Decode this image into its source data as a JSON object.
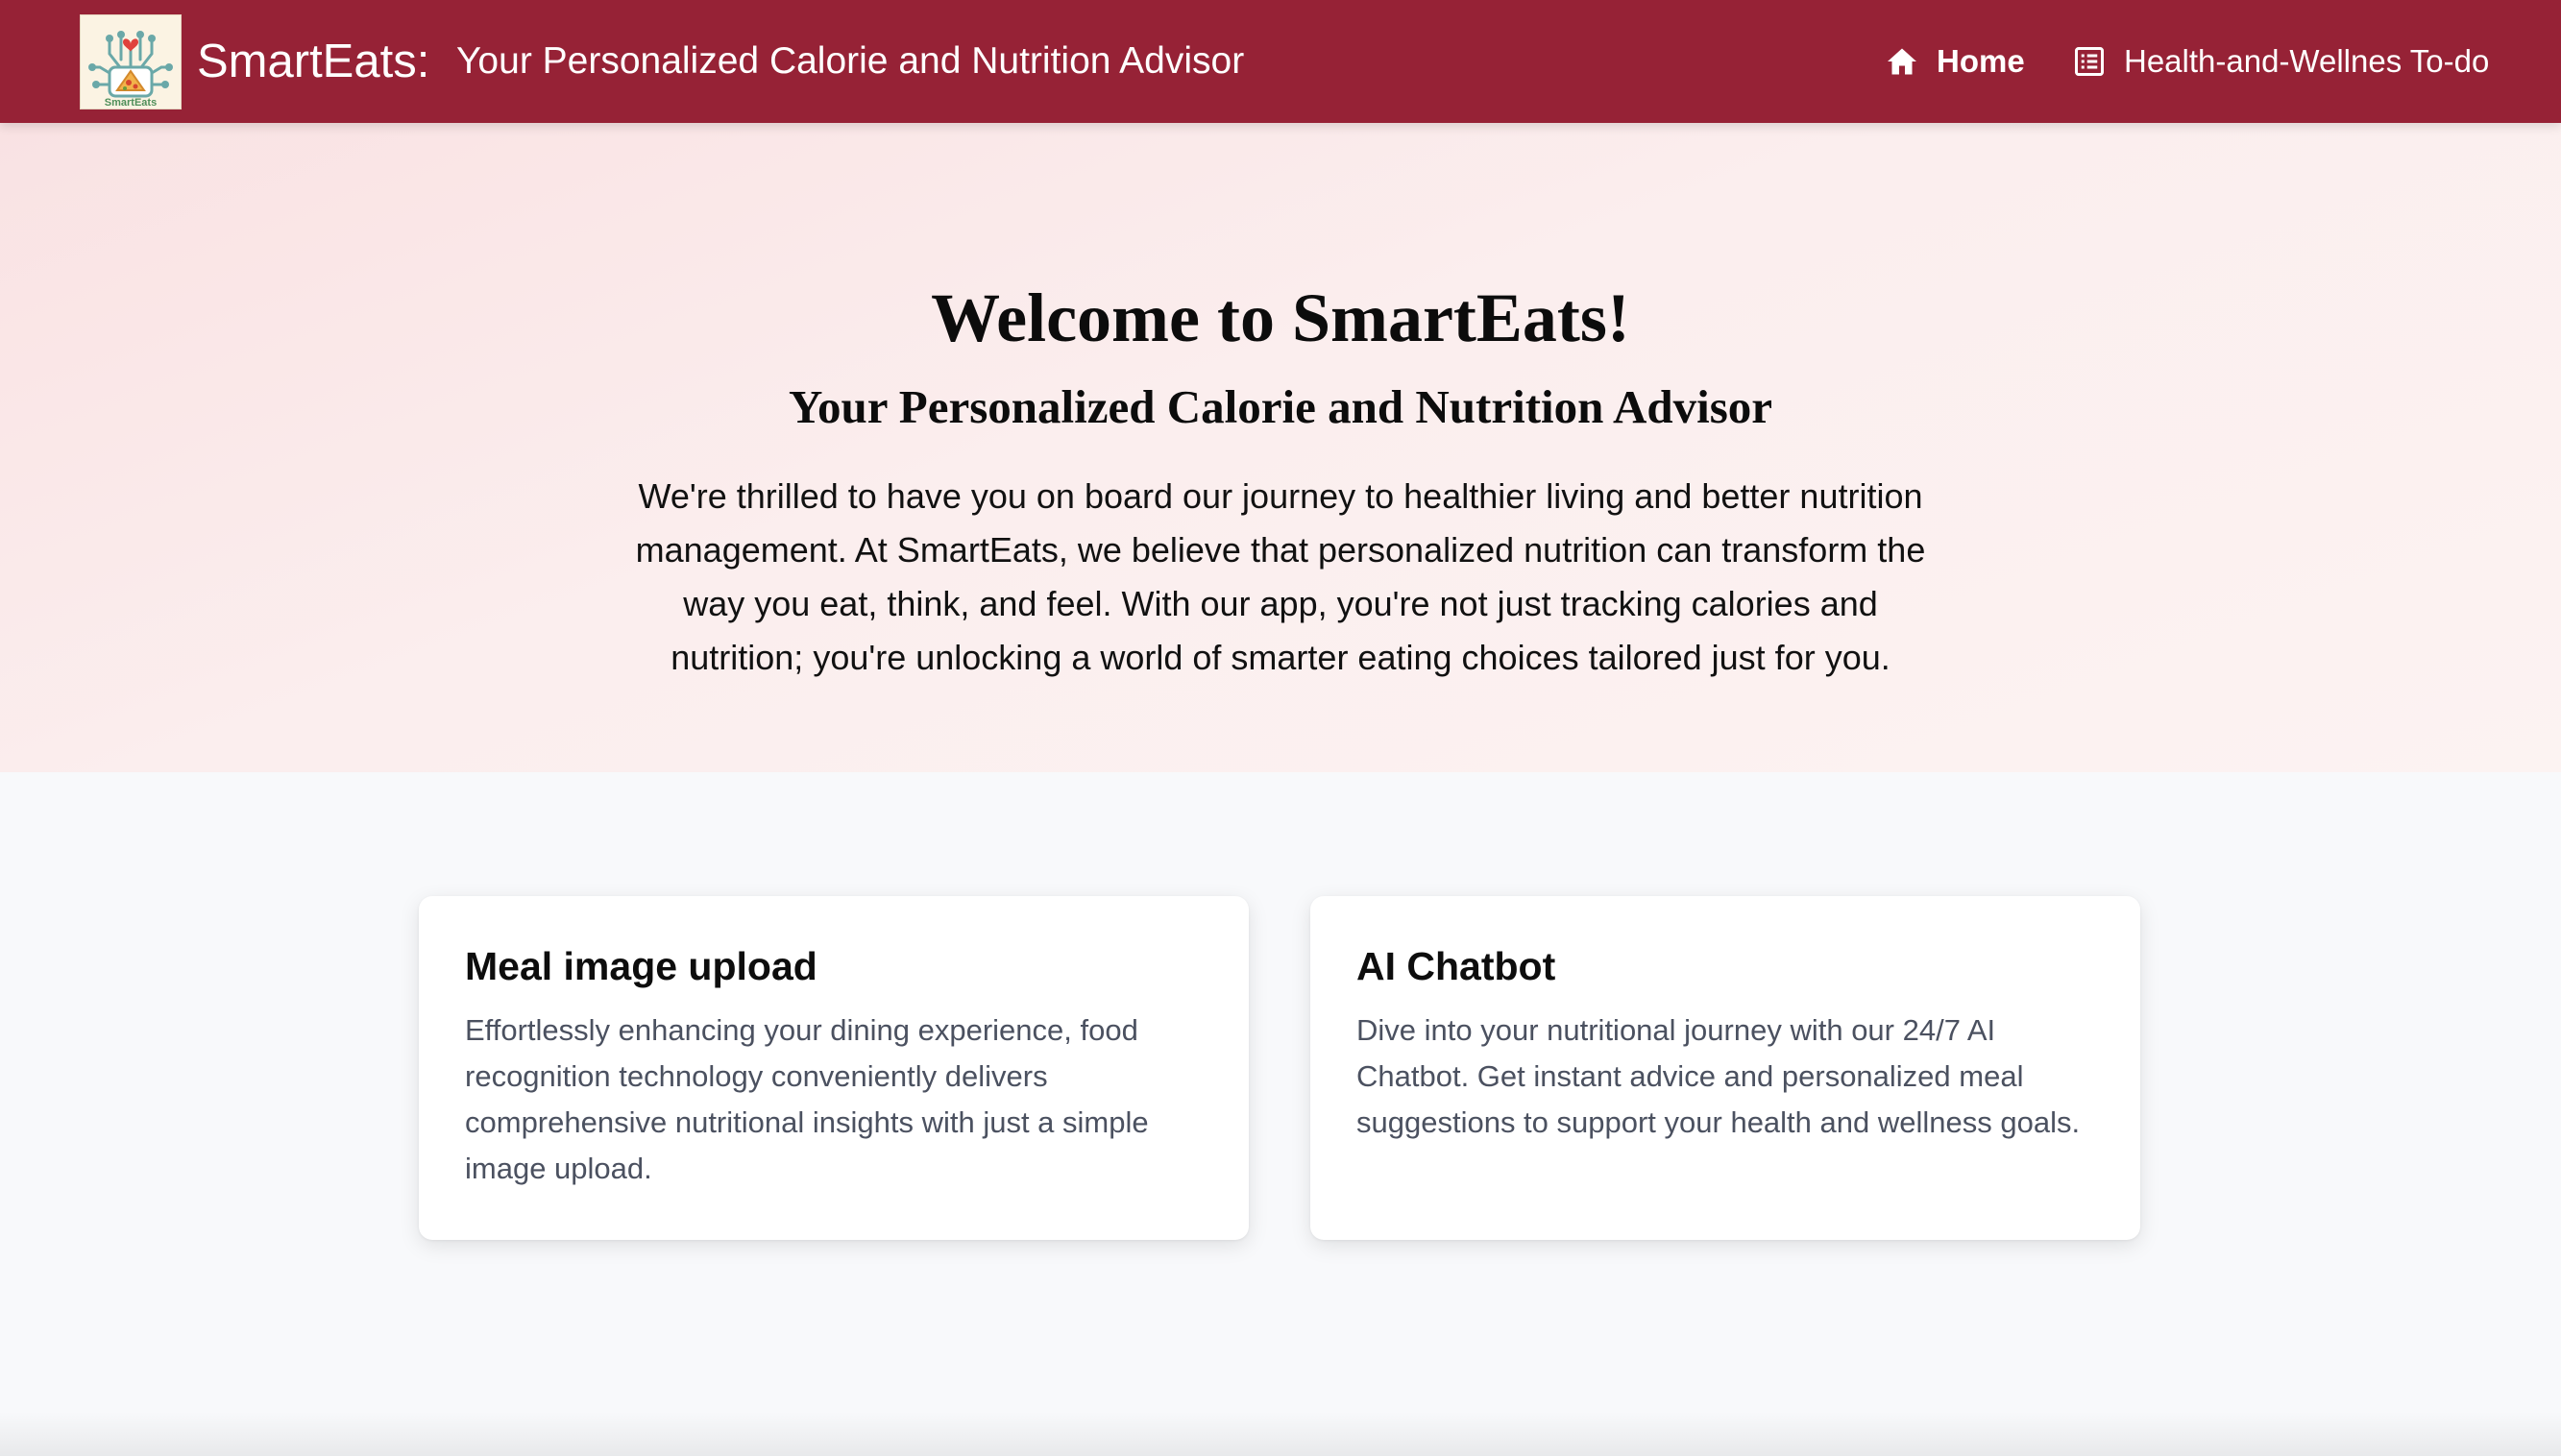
{
  "colors": {
    "navbar": "#962236",
    "hero_bg": "#fbeeee",
    "page_bg": "#f8f9fb",
    "card_text": "#4b5160"
  },
  "header": {
    "logo_alt": "SmartEats",
    "brand": "SmartEats:",
    "subtitle": "Your Personalized Calorie and Nutrition Advisor",
    "nav": [
      {
        "label": "Home",
        "icon": "home-icon",
        "active": true
      },
      {
        "label": "Health-and-Wellnes To-do",
        "icon": "list-icon",
        "active": false
      }
    ]
  },
  "hero": {
    "title": "Welcome to SmartEats!",
    "subtitle": "Your Personalized Calorie and Nutrition Advisor",
    "text": "We're thrilled to have you on board our journey to healthier living and better nutrition management. At SmartEats, we believe that personalized nutrition can transform the way you eat, think, and feel. With our app, you're not just tracking calories and nutrition; you're unlocking a world of smarter eating choices tailored just for you."
  },
  "features": [
    {
      "title": "Meal image upload",
      "text": "Effortlessly enhancing your dining experience, food recognition technology conveniently delivers comprehensive nutritional insights with just a simple image upload."
    },
    {
      "title": "AI Chatbot",
      "text": "Dive into your nutritional journey with our 24/7 AI Chatbot. Get instant advice and personalized meal suggestions to support your health and wellness goals."
    }
  ]
}
